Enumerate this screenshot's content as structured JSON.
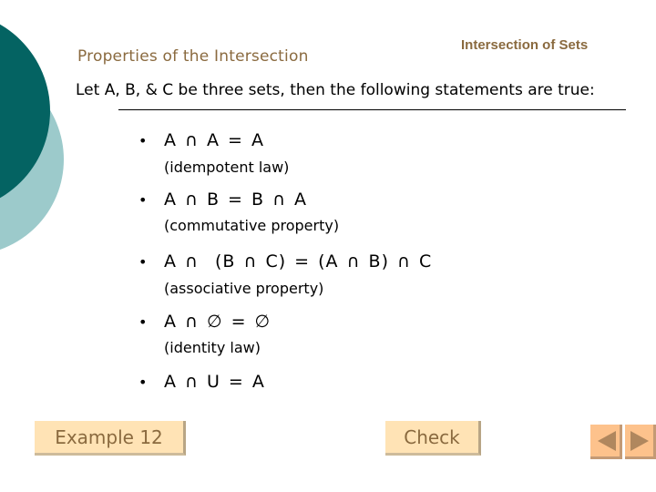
{
  "slide": {
    "title": "Properties of the Intersection",
    "header": "Intersection of Sets",
    "intro": "Let A, B, & C be three sets, then the following statements are true:"
  },
  "properties": [
    {
      "bullet": "•",
      "expression": "A ∩ A = A",
      "note": "(idempotent law)"
    },
    {
      "bullet": "•",
      "expression": "A ∩ B = B ∩ A",
      "note": "(commutative property)"
    },
    {
      "bullet": "•",
      "expression": "A ∩  (B ∩ C) = (A ∩ B) ∩ C",
      "note": "(associative property)"
    },
    {
      "bullet": "•",
      "expression": "A ∩ ∅ = ∅",
      "note": "(identity law)"
    },
    {
      "bullet": "•",
      "expression": "A ∩ U = A",
      "note": ""
    }
  ],
  "buttons": {
    "example": "Example 12",
    "check": "Check"
  },
  "navigation": {
    "prev_icon": "triangle-left",
    "next_icon": "triangle-right"
  },
  "colors": {
    "accent_brown": "#8a6a3f",
    "button_fill": "#ffe3b5",
    "nav_fill": "#fdc28c",
    "teal_dark": "#046362",
    "teal_light": "#9ccacb"
  }
}
